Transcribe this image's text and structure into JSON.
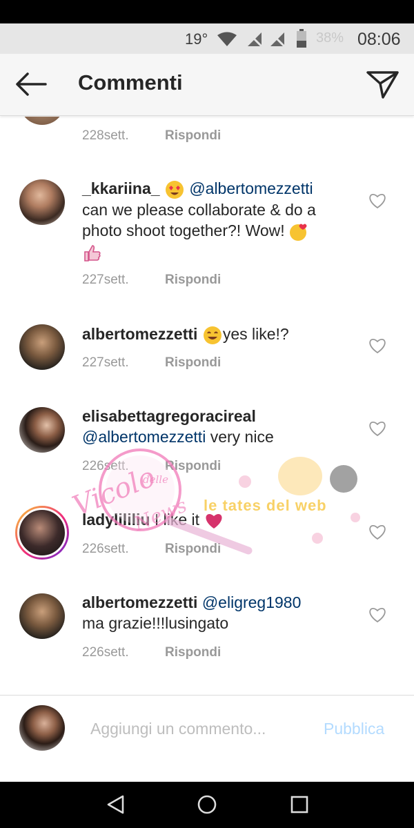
{
  "status_bar": {
    "temperature": "19°",
    "battery_percent": "38%",
    "time": "08:06",
    "icons": [
      "wifi-icon",
      "no-signal-icon",
      "no-signal-icon",
      "battery-icon"
    ]
  },
  "header": {
    "title": "Commenti",
    "back_icon": "arrow-left-icon",
    "send_icon": "paper-plane-icon"
  },
  "reply_label": "Rispondi",
  "comments": [
    {
      "username": "",
      "text": "",
      "time": "228sett."
    },
    {
      "username": "_kkariina_",
      "mention": "@albertomezzetti",
      "text_line1": "can we please collaborate & do a",
      "text_line2": "photo shoot together?! Wow!",
      "time": "227sett."
    },
    {
      "username": "albertomezzetti",
      "text": "yes like!?",
      "time": "227sett."
    },
    {
      "username": "elisabettagregoracireal",
      "mention": "@albertomezzetti",
      "text": "very nice",
      "time": "226sett."
    },
    {
      "username": "ladylililiu",
      "text": "I like it",
      "time": "226sett."
    },
    {
      "username": "albertomezzetti",
      "mention": "@eligreg1980",
      "text": "ma grazie!!!lusingato",
      "time": "226sett."
    }
  ],
  "input": {
    "placeholder": "Aggiungi un commento...",
    "publish_label": "Pubblica"
  },
  "watermark": {
    "line1": "Vicolo",
    "line2": "delle",
    "line3": "News",
    "line4": "le tates del web"
  },
  "navbar": {
    "icons": [
      "back-triangle-icon",
      "home-circle-icon",
      "recents-square-icon"
    ]
  },
  "colors": {
    "mention": "#003569",
    "publish_disabled": "#b3dbff",
    "muted": "#999999"
  }
}
